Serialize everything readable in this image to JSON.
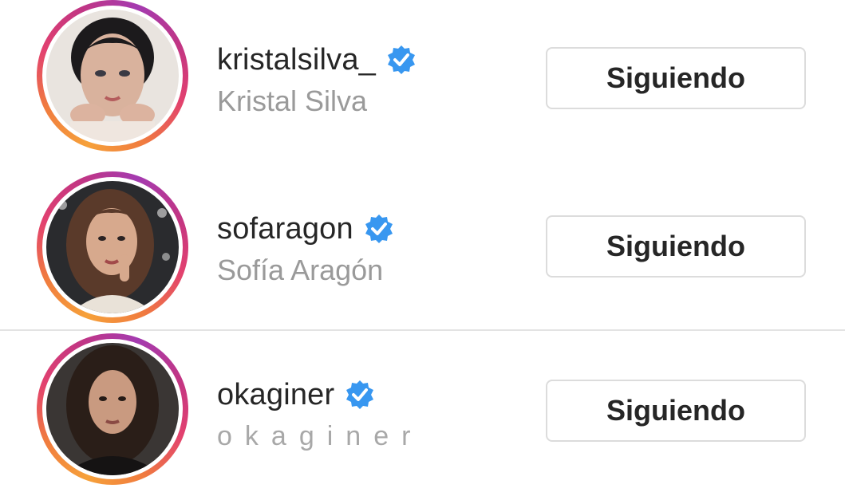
{
  "accounts": [
    {
      "username": "kristalsilva_",
      "full_name": "Kristal Silva",
      "verified": true,
      "button_label": "Siguiendo"
    },
    {
      "username": "sofaragon",
      "full_name": "Sofía Aragón",
      "verified": true,
      "button_label": "Siguiendo"
    },
    {
      "username": "okaginer",
      "full_name": "okaginer",
      "verified": true,
      "button_label": "Siguiendo"
    }
  ],
  "colors": {
    "verified_blue": "#3897f0",
    "username_text": "#262626",
    "fullname_text": "#9a9a9a",
    "button_border": "#dcdcdc",
    "story_ring_start": "#f6a13a",
    "story_ring_end": "#c13584"
  },
  "icons": {
    "verified": "verified-badge-icon",
    "avatar": "profile-photo"
  }
}
